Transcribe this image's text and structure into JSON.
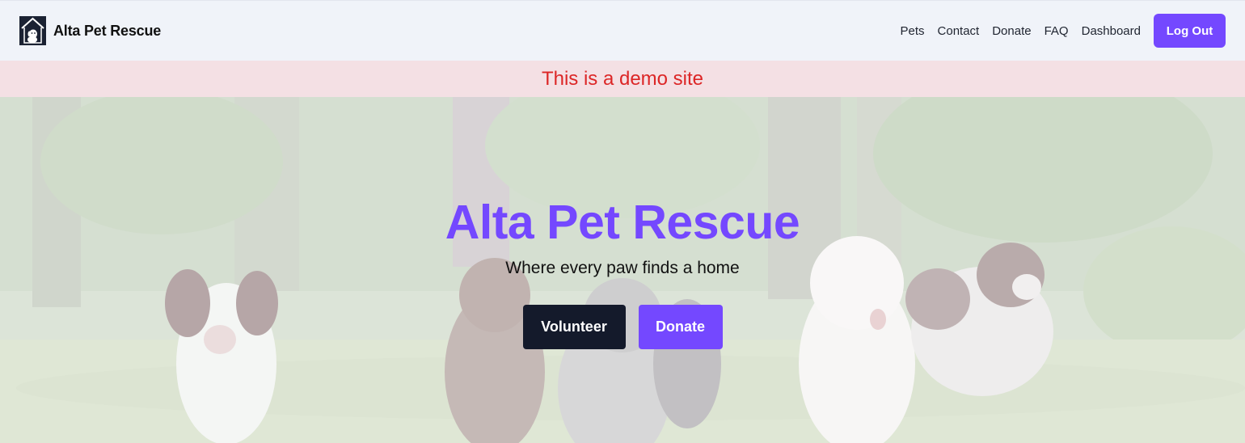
{
  "navbar": {
    "brand_name": "Alta Pet Rescue",
    "logo_icon": "dog-house-logo-icon",
    "links": [
      "Pets",
      "Contact",
      "Donate",
      "FAQ",
      "Dashboard"
    ],
    "logout_label": "Log Out"
  },
  "banner": {
    "text": "This is a demo site"
  },
  "hero": {
    "title": "Alta Pet Rescue",
    "subtitle": "Where every paw finds a home",
    "volunteer_label": "Volunteer",
    "donate_label": "Donate"
  },
  "colors": {
    "accent": "#7448ff",
    "dark_button": "#141a2b",
    "banner_bg": "#f4e0e4",
    "banner_text": "#dc2626",
    "nav_bg": "#f0f3f9"
  }
}
